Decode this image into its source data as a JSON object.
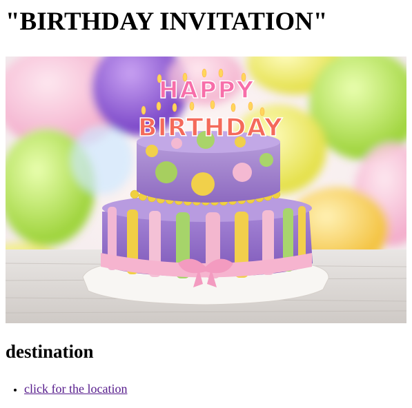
{
  "page": {
    "title": "\"BIRTHDAY INVITATION\"",
    "image": {
      "alt": "birthday cake",
      "candle_text_top": "HAPPY",
      "candle_text_bottom": "BIRTHDAY"
    },
    "section_heading": "destination",
    "links": [
      {
        "label": "click for the location"
      }
    ]
  },
  "colors": {
    "link_visited": "#551a8b",
    "text": "#000000",
    "background": "#ffffff"
  }
}
